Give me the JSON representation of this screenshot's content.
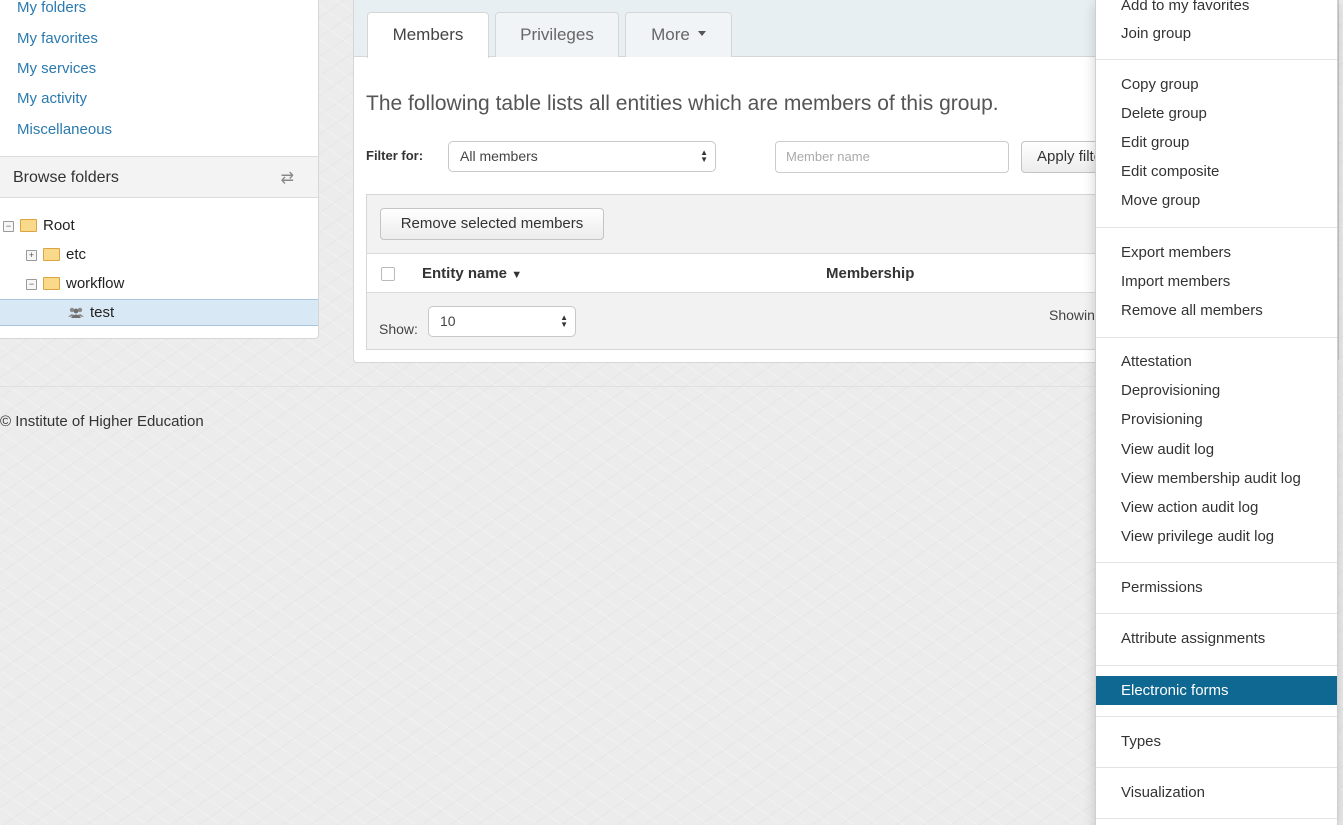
{
  "sidebar": {
    "links": [
      "My folders",
      "My favorites",
      "My services",
      "My activity",
      "Miscellaneous"
    ],
    "browse_title": "Browse folders",
    "tree": {
      "root": "Root",
      "etc": "etc",
      "workflow": "workflow",
      "selected": "test"
    }
  },
  "footer": {
    "text": "© Institute of Higher Education"
  },
  "main": {
    "tabs": {
      "members": "Members",
      "privileges": "Privileges",
      "more": "More"
    },
    "lead": "The following table lists all entities which are members of this group.",
    "filter_label": "Filter for:",
    "filter_value": "All members",
    "member_placeholder": "Member name",
    "apply_filter": "Apply filter",
    "remove_selected": "Remove selected members",
    "columns": {
      "entity_name": "Entity name",
      "membership": "Membership"
    },
    "show_label": "Show:",
    "show_value": "10",
    "showing": "Showing"
  },
  "menu": {
    "top_items": [
      "Add to my favorites",
      "Join group"
    ],
    "group_actions": [
      "Copy group",
      "Delete group",
      "Edit group",
      "Edit composite",
      "Move group"
    ],
    "member_actions": [
      "Export members",
      "Import members",
      "Remove all members"
    ],
    "audit_actions": [
      "Attestation",
      "Deprovisioning",
      "Provisioning",
      "View audit log",
      "View membership audit log",
      "View action audit log",
      "View privilege audit log"
    ],
    "permissions": "Permissions",
    "attribute_assignments": "Attribute assignments",
    "electronic_forms": "Electronic forms",
    "types": "Types",
    "visualization": "Visualization"
  },
  "colors": {
    "link": "#2a7ab0",
    "menu_active": "#0e6891",
    "selected_row": "#d8e8f5"
  }
}
